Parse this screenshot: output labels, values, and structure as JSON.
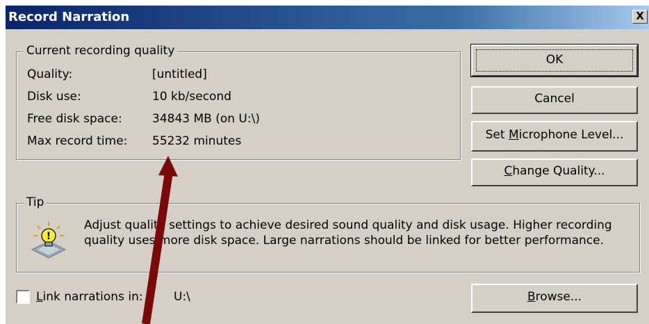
{
  "window": {
    "title": "Record Narration",
    "close_label": "X"
  },
  "quality_group": {
    "legend": "Current recording quality",
    "rows": [
      {
        "label": "Quality:",
        "value": "[untitled]"
      },
      {
        "label": "Disk use:",
        "value": "10 kb/second"
      },
      {
        "label": "Free disk space:",
        "value": "34843 MB (on U:\\)"
      },
      {
        "label": "Max record time:",
        "value": "55232 minutes"
      }
    ]
  },
  "buttons": {
    "ok": "OK",
    "cancel": "Cancel",
    "mic_pre": "Set ",
    "mic_u": "M",
    "mic_post": "icrophone Level...",
    "cq_u": "C",
    "cq_post": "hange Quality...",
    "browse_u": "B",
    "browse_post": "rowse..."
  },
  "tip": {
    "legend": "Tip",
    "text": "Adjust quality settings to achieve desired sound quality and disk usage. Higher recording quality uses more disk space. Large narrations should be linked for better performance.",
    "icon": "lightbulb-icon"
  },
  "link": {
    "checked": false,
    "label_u": "L",
    "label_post": "ink narrations in:",
    "path": "U:\\"
  },
  "annotation": {
    "arrow_color": "#7a0a0a"
  }
}
